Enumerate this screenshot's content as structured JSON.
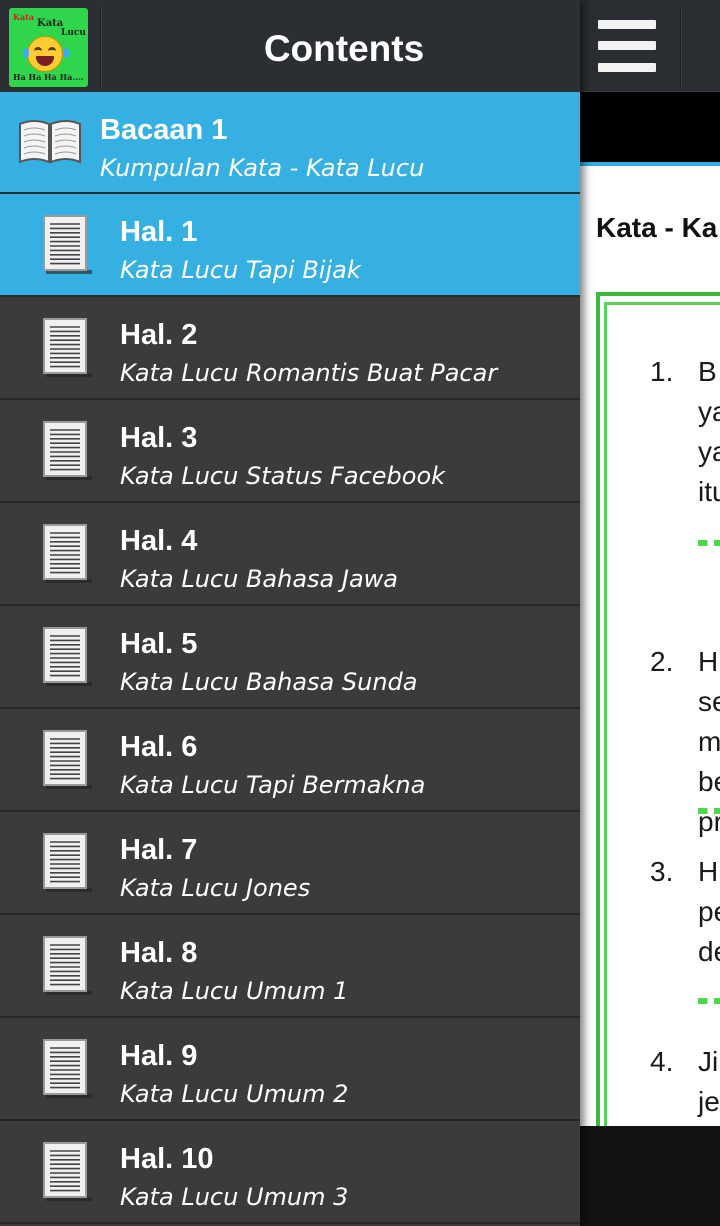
{
  "drawer": {
    "title": "Contents",
    "app_icon": {
      "name": "kata-lucu-app-icon",
      "text_lines": [
        "Kata",
        "Lucu",
        "Ha Ha Ha Ha...."
      ]
    },
    "book": {
      "title": "Bacaan 1",
      "subtitle": "Kumpulan Kata - Kata Lucu",
      "icon": "open-book-icon"
    },
    "items": [
      {
        "title": "Hal. 1",
        "subtitle": "Kata Lucu Tapi Bijak",
        "selected": true
      },
      {
        "title": "Hal. 2",
        "subtitle": "Kata Lucu Romantis Buat Pacar",
        "selected": false
      },
      {
        "title": "Hal. 3",
        "subtitle": "Kata Lucu Status Facebook",
        "selected": false
      },
      {
        "title": "Hal. 4",
        "subtitle": "Kata Lucu Bahasa Jawa",
        "selected": false
      },
      {
        "title": "Hal. 5",
        "subtitle": "Kata Lucu Bahasa Sunda",
        "selected": false
      },
      {
        "title": "Hal. 6",
        "subtitle": "Kata Lucu Tapi Bermakna",
        "selected": false
      },
      {
        "title": "Hal. 7",
        "subtitle": "Kata Lucu Jones",
        "selected": false
      },
      {
        "title": "Hal. 8",
        "subtitle": "Kata Lucu Umum 1",
        "selected": false
      },
      {
        "title": "Hal. 9",
        "subtitle": "Kata Lucu Umum 2",
        "selected": false
      },
      {
        "title": "Hal. 10",
        "subtitle": "Kata Lucu Umum 3",
        "selected": false
      }
    ],
    "item_icon": "document-page-icon"
  },
  "content": {
    "menu_icon": "hamburger-menu-icon",
    "heading": "Kata - Ka",
    "list": [
      {
        "num": "1.",
        "lines": [
          "B",
          "ya",
          "ya",
          "itu"
        ]
      },
      {
        "num": "2.",
        "lines": [
          "H",
          "se",
          "m",
          "be",
          "pr"
        ]
      },
      {
        "num": "3.",
        "lines": [
          "H",
          "pe",
          "de"
        ]
      },
      {
        "num": "4.",
        "lines": [
          "Ji",
          "je"
        ]
      }
    ]
  },
  "colors": {
    "selected_bg": "#36b0e2",
    "drawer_bg": "#3b3b3b",
    "header_bg": "#2b2f34",
    "accent_green": "#3cb83c"
  }
}
